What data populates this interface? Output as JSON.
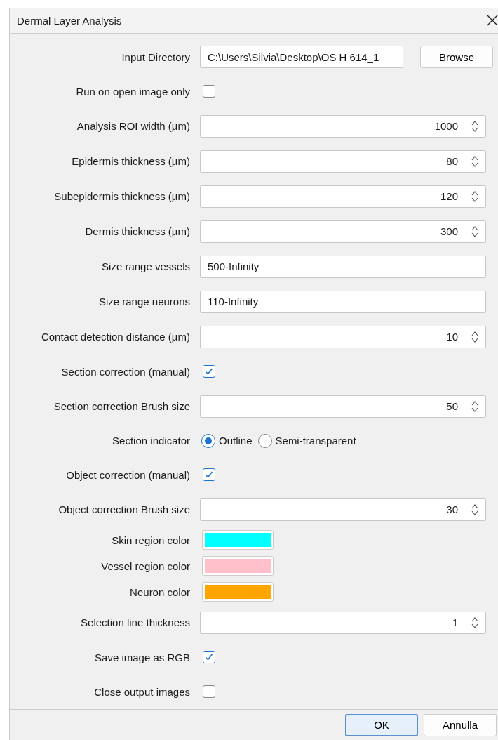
{
  "window": {
    "title": "Dermal Layer Analysis"
  },
  "fields": [
    {
      "kind": "directory",
      "label": "Input Directory",
      "value": "C:\\Users\\Silvia\\Desktop\\OS H 614_1",
      "button": "Browse"
    },
    {
      "kind": "checkbox",
      "label": "Run on open image only",
      "checked": false
    },
    {
      "kind": "spin",
      "label": "Analysis ROI width (µm)",
      "value": "1000"
    },
    {
      "kind": "spin",
      "label": "Epidermis thickness (µm)",
      "value": "80"
    },
    {
      "kind": "spin",
      "label": "Subepidermis thickness (µm)",
      "value": "120"
    },
    {
      "kind": "spin",
      "label": "Dermis thickness (µm)",
      "value": "300"
    },
    {
      "kind": "text",
      "label": "Size range vessels",
      "value": "500-Infinity"
    },
    {
      "kind": "text",
      "label": "Size range neurons",
      "value": "110-Infinity"
    },
    {
      "kind": "spin",
      "label": "Contact detection distance (µm)",
      "value": "10"
    },
    {
      "kind": "checkbox",
      "label": "Section correction (manual)",
      "checked": true
    },
    {
      "kind": "spin",
      "label": "Section correction Brush size",
      "value": "50"
    },
    {
      "kind": "radio",
      "label": "Section indicator",
      "options": [
        {
          "label": "Outline",
          "selected": true
        },
        {
          "label": "Semi-transparent",
          "selected": false
        }
      ]
    },
    {
      "kind": "checkbox",
      "label": "Object correction (manual)",
      "checked": true
    },
    {
      "kind": "spin",
      "label": "Object correction Brush size",
      "value": "30"
    },
    {
      "kind": "color",
      "label": "Skin region color",
      "color": "#00ffff"
    },
    {
      "kind": "color",
      "label": "Vessel region color",
      "color": "#ffc0cb"
    },
    {
      "kind": "color",
      "label": "Neuron color",
      "color": "#ffa500"
    },
    {
      "kind": "spin",
      "label": "Selection line thickness",
      "value": "1"
    },
    {
      "kind": "checkbox",
      "label": "Save image as RGB",
      "checked": true
    },
    {
      "kind": "checkbox",
      "label": "Close output images",
      "checked": false
    }
  ],
  "buttons": [
    {
      "label": "OK",
      "default": true
    },
    {
      "label": "Annulla",
      "default": false
    }
  ]
}
